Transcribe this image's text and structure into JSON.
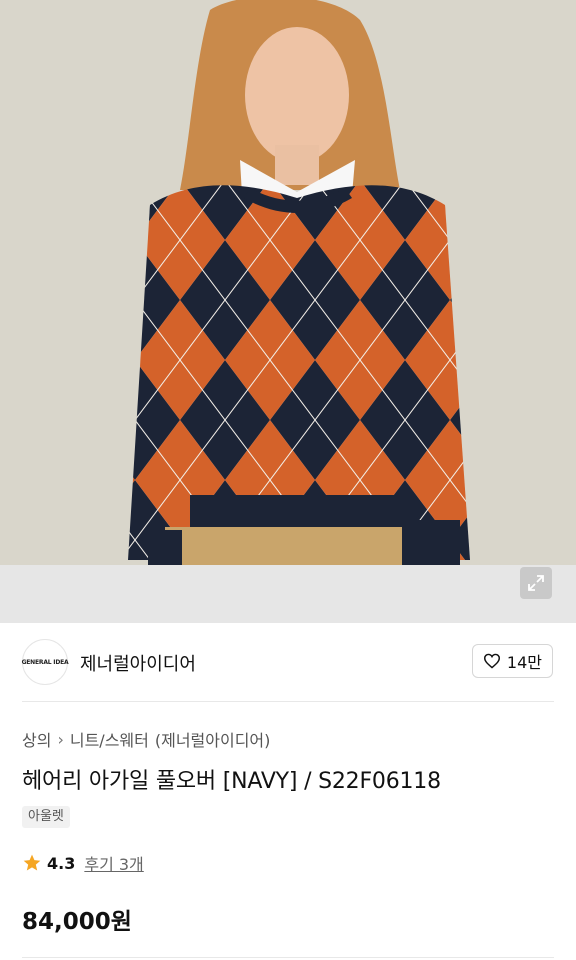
{
  "product_image": {
    "alt": "argyle sweater product photo"
  },
  "brand": {
    "logo_text": "GENERAL IDEA",
    "name": "제너럴아이디어"
  },
  "like": {
    "count": "14만"
  },
  "breadcrumb": {
    "category": "상의",
    "subcategory": "니트/스웨터",
    "brand": "(제너럴아이디어)"
  },
  "product": {
    "title": "헤어리 아가일 풀오버 [NAVY] / S22F06118",
    "badge": "아울렛",
    "rating": "4.3",
    "reviews": "후기 3개",
    "price": "84,000원"
  },
  "colors": {
    "star": "#f5a623",
    "sweater_orange": "#d4622a",
    "sweater_navy": "#1c2436",
    "sweater_cream": "#e9e0d3"
  },
  "icons": {
    "expand": "expand-icon",
    "heart": "heart-icon",
    "star": "star-icon",
    "chevron": "chevron-right-icon"
  }
}
